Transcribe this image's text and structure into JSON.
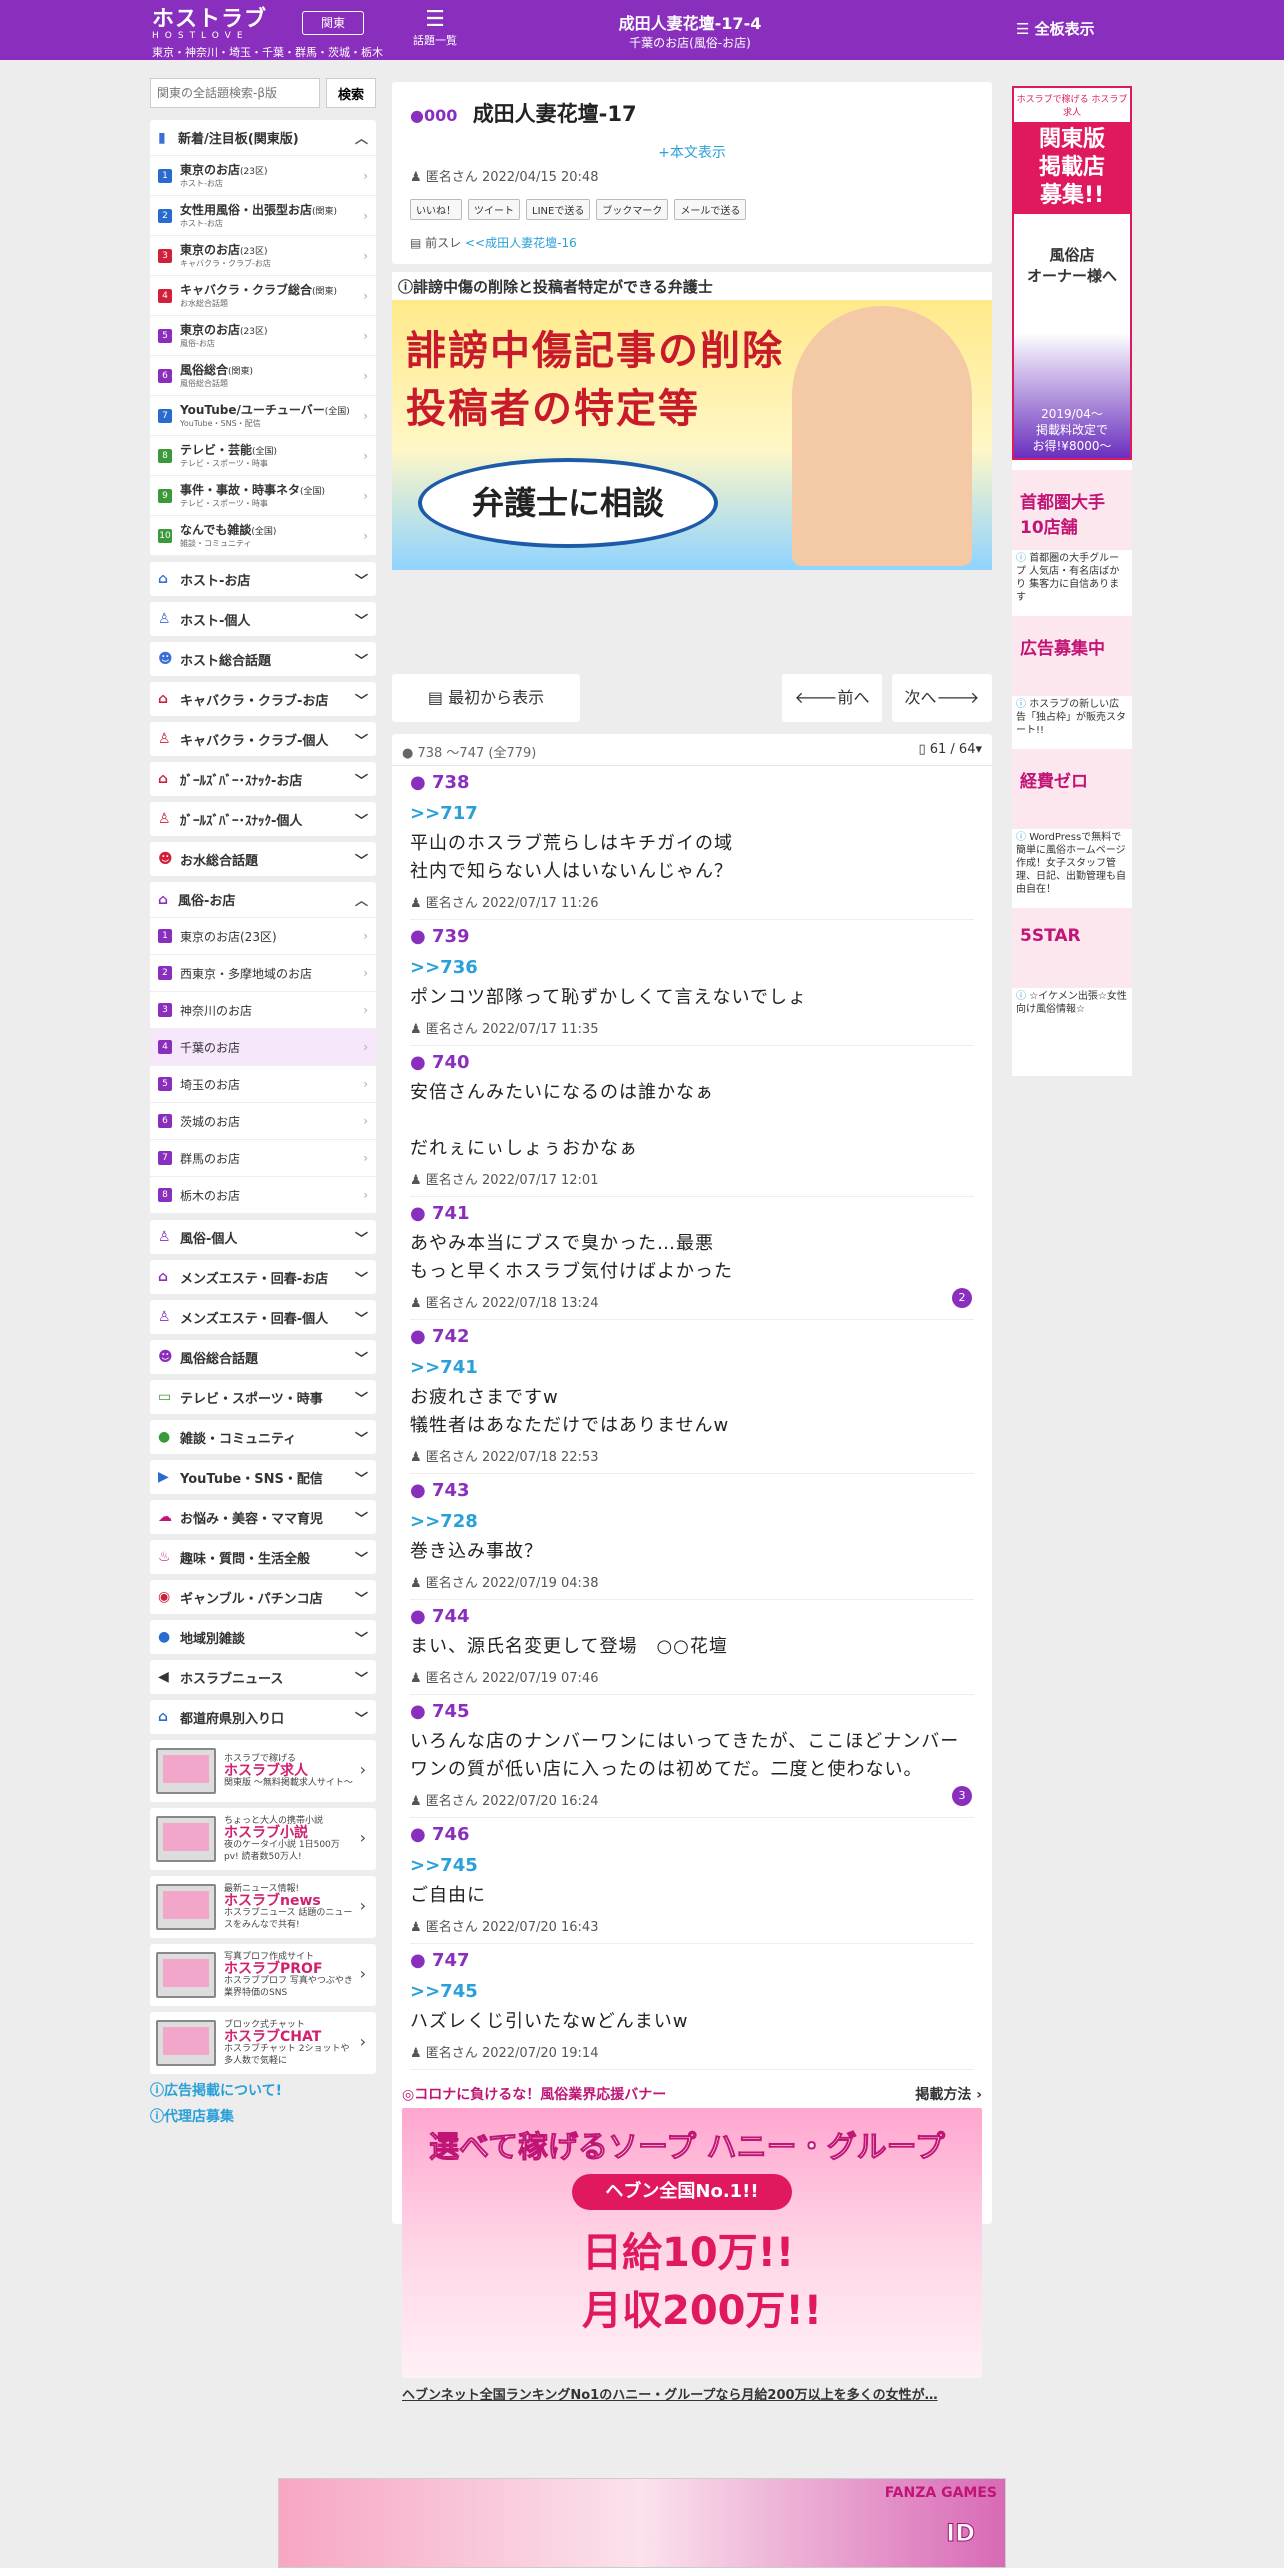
{
  "header": {
    "logo": "ホストラブ",
    "logo_sub": "HOSTLOVE",
    "region_btn": "関東",
    "areas": "東京・神奈川・埼玉・千葉・群馬・茨城・栃木",
    "topics_label": "話題一覧",
    "title": "成田人妻花壇-17-4",
    "subtitle": "千葉のお店(風俗-お店)",
    "full_label": "全板表示"
  },
  "search": {
    "placeholder": "関東の全話題検索-β版",
    "button": "検索"
  },
  "sidebar": {
    "new_title": "新着/注目板(関東版)",
    "new_items": [
      {
        "n": "1",
        "title": "東京のお店",
        "tag": "(23区)",
        "sub": "ホスト-お店",
        "color": "#2a6bd0"
      },
      {
        "n": "2",
        "title": "女性用風俗・出張型お店",
        "tag": "(関東)",
        "sub": "ホスト-お店",
        "color": "#2a6bd0"
      },
      {
        "n": "3",
        "title": "東京のお店",
        "tag": "(23区)",
        "sub": "キャバクラ・クラブ-お店",
        "color": "#d0203a"
      },
      {
        "n": "4",
        "title": "キャバクラ・クラブ総合",
        "tag": "(関東)",
        "sub": "お水総合話題",
        "color": "#d0203a"
      },
      {
        "n": "5",
        "title": "東京のお店",
        "tag": "(23区)",
        "sub": "風俗-お店",
        "color": "#8a2fbd"
      },
      {
        "n": "6",
        "title": "風俗総合",
        "tag": "(関東)",
        "sub": "風俗総合話題",
        "color": "#8a2fbd"
      },
      {
        "n": "7",
        "title": "YouTube/ユーチューバー",
        "tag": "(全国)",
        "sub": "YouTube・SNS・配信",
        "color": "#2a6bd0"
      },
      {
        "n": "8",
        "title": "テレビ・芸能",
        "tag": "(全国)",
        "sub": "テレビ・スポーツ・時事",
        "color": "#3a9a3a"
      },
      {
        "n": "9",
        "title": "事件・事故・時事ネタ",
        "tag": "(全国)",
        "sub": "テレビ・スポーツ・時事",
        "color": "#3a9a3a"
      },
      {
        "n": "10",
        "title": "なんでも雑談",
        "tag": "(全国)",
        "sub": "雑談・コミュニティ",
        "color": "#3a9a3a"
      }
    ],
    "cats_a": [
      {
        "label": "ホスト-お店",
        "icon": "⌂",
        "color": "#3a6fd4"
      },
      {
        "label": "ホスト-個人",
        "icon": "♙",
        "color": "#3a6fd4"
      },
      {
        "label": "ホスト総合話題",
        "icon": "☻",
        "color": "#3a6fd4"
      },
      {
        "label": "キャバクラ・クラブ-お店",
        "icon": "⌂",
        "color": "#d0203a"
      },
      {
        "label": "キャバクラ・クラブ-個人",
        "icon": "♙",
        "color": "#d0203a"
      },
      {
        "label": "ｶﾞｰﾙｽﾞﾊﾞｰ･ｽﾅｯｸ-お店",
        "icon": "⌂",
        "color": "#d0203a"
      },
      {
        "label": "ｶﾞｰﾙｽﾞﾊﾞｰ･ｽﾅｯｸ-個人",
        "icon": "♙",
        "color": "#d0203a"
      },
      {
        "label": "お水総合話題",
        "icon": "☻",
        "color": "#d0203a"
      }
    ],
    "fuzoku_title": "風俗-お店",
    "fuzoku_items": [
      "東京のお店(23区)",
      "西東京・多摩地域のお店",
      "神奈川のお店",
      "千葉のお店",
      "埼玉のお店",
      "茨城のお店",
      "群馬のお店",
      "栃木のお店"
    ],
    "cats_b": [
      {
        "label": "風俗-個人",
        "icon": "♙",
        "color": "#8a2fbd"
      },
      {
        "label": "メンズエステ・回春-お店",
        "icon": "⌂",
        "color": "#8a2fbd"
      },
      {
        "label": "メンズエステ・回春-個人",
        "icon": "♙",
        "color": "#8a2fbd"
      },
      {
        "label": "風俗総合話題",
        "icon": "☻",
        "color": "#8a2fbd"
      },
      {
        "label": "テレビ・スポーツ・時事",
        "icon": "▭",
        "color": "#3a9a3a"
      },
      {
        "label": "雑談・コミュニティ",
        "icon": "●",
        "color": "#3a9a3a"
      },
      {
        "label": "YouTube・SNS・配信",
        "icon": "▶",
        "color": "#2a6bd0"
      },
      {
        "label": "お悩み・美容・ママ育児",
        "icon": "☁",
        "color": "#c11576"
      },
      {
        "label": "趣味・質問・生活全般",
        "icon": "♨",
        "color": "#c11576"
      },
      {
        "label": "ギャンブル・パチンコ店",
        "icon": "◉",
        "color": "#d0203a"
      },
      {
        "label": "地域別雑談",
        "icon": "●",
        "color": "#2a6bd0"
      },
      {
        "label": "ホスラブニュース",
        "icon": "◀",
        "color": "#333"
      },
      {
        "label": "都道府県別入り口",
        "icon": "⌂",
        "color": "#2a6bd0"
      }
    ],
    "promos": [
      {
        "top": "ホスラブで稼げる",
        "title": "ホスラブ求人",
        "sub": "関東版 ～無料掲載求人サイト～"
      },
      {
        "top": "ちょっと大人の携帯小説",
        "title": "ホスラブ小説",
        "sub": "夜のケータイ小説 1日500万pv! 読者数50万人!"
      },
      {
        "top": "最新ニュース情報!",
        "title": "ホスラブnews",
        "sub": "ホスラブニュース 話題のニュースをみんなで共有!"
      },
      {
        "top": "写真プロフ作成サイト",
        "title": "ホスラブPROF",
        "sub": "ホスラブプロフ 写真やつぶやき業界特価のSNS"
      },
      {
        "top": "ブロック式チャット",
        "title": "ホスラブCHAT",
        "sub": "ホスラブチャット 2ショットや多人数で気軽に"
      }
    ],
    "ad_link": "広告掲載について!",
    "agency_link": "代理店募集"
  },
  "thread": {
    "no": "000",
    "title": "成田人妻花壇-17",
    "more": "+本文表示",
    "author": "匿名さん",
    "date": "2022/04/15 20:48",
    "shares": [
      "いいね！",
      "ツイート",
      "LINEで送る",
      "ブックマーク",
      "メールで送る"
    ],
    "prev_label": "前スレ",
    "prev_link": "<<成田人妻花壇-16"
  },
  "lawyer_ad": {
    "caption": "誹謗中傷の削除と投稿者特定ができる弁護士",
    "line1": "誹謗中傷記事の削除",
    "line2": "投稿者の特定等",
    "oval": "弁護士に相談"
  },
  "nav": {
    "first": "最初から表示",
    "prev": "前へ",
    "next": "次へ"
  },
  "posts_header": {
    "range": "738 ～747 (全779)",
    "page": "61 / 64"
  },
  "posts": [
    {
      "no": "738",
      "anchor": ">>717",
      "body": "平山のホスラブ荒らしはキチガイの域\n社内で知らない人はいないんじゃん？",
      "author": "匿名さん",
      "date": "2022/07/17 11:26",
      "badge": ""
    },
    {
      "no": "739",
      "anchor": ">>736",
      "body": "ポンコツ部隊って恥ずかしくて言えないでしょ",
      "author": "匿名さん",
      "date": "2022/07/17 11:35",
      "badge": ""
    },
    {
      "no": "740",
      "anchor": "",
      "body": "安倍さんみたいになるのは誰かなぁ\n\nだれぇにぃしょぅおかなぁ",
      "author": "匿名さん",
      "date": "2022/07/17 12:01",
      "badge": ""
    },
    {
      "no": "741",
      "anchor": "",
      "body": "あやみ本当にブスで臭かった…最悪\nもっと早くホスラブ気付けばよかった",
      "author": "匿名さん",
      "date": "2022/07/18 13:24",
      "badge": "2"
    },
    {
      "no": "742",
      "anchor": ">>741",
      "body": "お疲れさまですw\n犠牲者はあなただけではありませんw",
      "author": "匿名さん",
      "date": "2022/07/18 22:53",
      "badge": ""
    },
    {
      "no": "743",
      "anchor": ">>728",
      "body": "巻き込み事故？",
      "author": "匿名さん",
      "date": "2022/07/19 04:38",
      "badge": ""
    },
    {
      "no": "744",
      "anchor": "",
      "body": "まい、源氏名変更して登場　○○花壇",
      "author": "匿名さん",
      "date": "2022/07/19 07:46",
      "badge": ""
    },
    {
      "no": "745",
      "anchor": "",
      "body": "いろんな店のナンバーワンにはいってきたが、ここほどナンバーワンの質が低い店に入ったのは初めてだ。二度と使わない。",
      "author": "匿名さん",
      "date": "2022/07/20 16:24",
      "badge": "3"
    },
    {
      "no": "746",
      "anchor": ">>745",
      "body": "ご自由に",
      "author": "匿名さん",
      "date": "2022/07/20 16:43",
      "badge": ""
    },
    {
      "no": "747",
      "anchor": ">>745",
      "body": "ハズレくじ引いたなwどんまいw",
      "author": "匿名さん",
      "date": "2022/07/20 19:14",
      "badge": ""
    }
  ],
  "corona": {
    "label": "◎コロナに負けるな！風俗業界応援バナー",
    "howto": "掲載方法",
    "ban_title": "選べて稼げるソープ ハニー・グループ",
    "ban_pill": "ヘブン全国No.1!!",
    "ban_pay1": "日給10万!!",
    "ban_pay2": "月収200万!!",
    "footer": "ヘブンネット全国ランキングNo1のハニー・グループなら月給200万以上を多くの女性が…"
  },
  "right_ads": {
    "ad1_top": "ホスラブで稼げる ホスラブ求人",
    "ad1_big": "関東版\n掲載店\n募集!!",
    "ad1_mid": "風俗店\nオーナー様へ",
    "ad1_foot": "2019/04～\n掲載料改定で\nお得!¥8000～",
    "small": [
      {
        "img": "首都圏大手\n10店舗",
        "text": "首都圏の大手グループ 人気店・有名店ばかり 集客力に自信あります"
      },
      {
        "img": "広告募集中",
        "text": "ホスラブの新しい広告「独占枠」が販売スタート!!"
      },
      {
        "img": "経費ゼロ",
        "text": "WordPressで無料で簡単に風俗ホームページ作成！女子スタッフ管理、日記、出勤管理も自由自在！"
      },
      {
        "img": "5STAR",
        "text": "☆イケメン出張☆女性向け風俗情報☆"
      }
    ]
  },
  "bottom_banner": {
    "brand": "FANZA GAMES",
    "title": "ID"
  }
}
